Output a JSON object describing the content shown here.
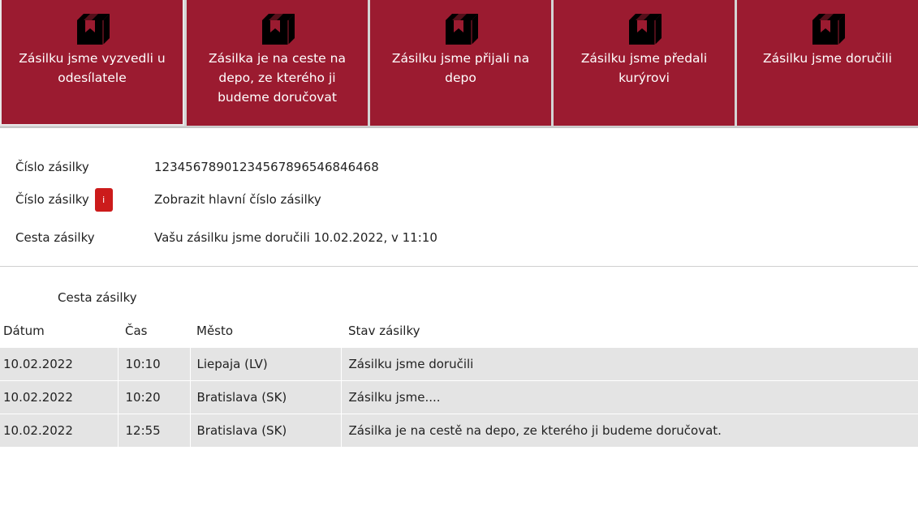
{
  "colors": {
    "step_background": "#9b1b30",
    "info_badge": "#cc1b1b",
    "row_background": "#e4e4e4"
  },
  "steps": [
    {
      "icon": "package-icon",
      "label": "Zásilku jsme vyzvedli u odesílatele"
    },
    {
      "icon": "package-icon",
      "label": "Zásilka je na ceste na depo, ze kterého ji budeme doručovat"
    },
    {
      "icon": "package-icon",
      "label": "Zásilku jsme přijali na depo"
    },
    {
      "icon": "package-icon",
      "label": "Zásilku jsme předali kurýrovi"
    },
    {
      "icon": "package-icon",
      "label": "Zásilku jsme doručili"
    }
  ],
  "info": {
    "parcel_number_label": "Číslo zásilky",
    "parcel_number_value": "12345678901234567896546846468",
    "main_number_label": "Číslo zásilky",
    "main_number_badge": "i",
    "main_number_link": "Zobrazit hlavní číslo zásilky",
    "route_label": "Cesta zásilky",
    "route_value": "Vašu zásilku jsme doručili 10.02.2022, v 11:10"
  },
  "history": {
    "title": "Cesta zásilky",
    "columns": [
      "Dátum",
      "Čas",
      "Město",
      "Stav zásilky"
    ],
    "rows": [
      {
        "date": "10.02.2022",
        "time": "10:10",
        "city": "Liepaja (LV)",
        "status": "Zásilku jsme doručili"
      },
      {
        "date": "10.02.2022",
        "time": "10:20",
        "city": "Bratislava (SK)",
        "status": "Zásilku jsme...."
      },
      {
        "date": "10.02.2022",
        "time": "12:55",
        "city": "Bratislava (SK)",
        "status": "Zásilka je na cestě na depo, ze kterého ji budeme doručovat."
      }
    ]
  }
}
